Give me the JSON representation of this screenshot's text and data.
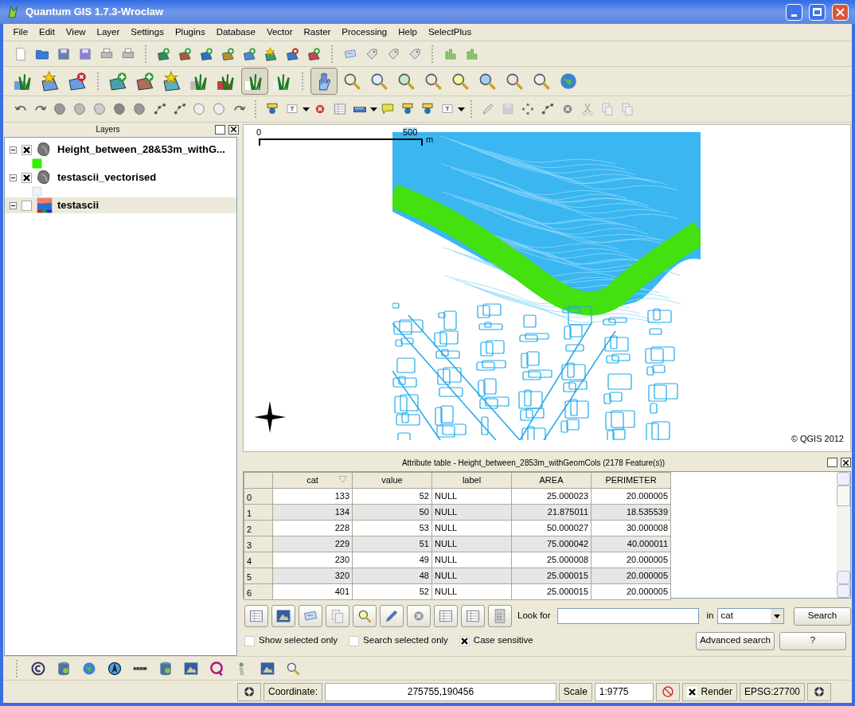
{
  "window": {
    "title": "Quantum GIS 1.7.3-Wroclaw"
  },
  "menu": [
    "File",
    "Edit",
    "View",
    "Layer",
    "Settings",
    "Plugins",
    "Database",
    "Vector",
    "Raster",
    "Processing",
    "Help",
    "SelectPlus"
  ],
  "toolbars": {
    "pan_tool": {
      "selected": true
    },
    "capture_tool": {
      "selected": true
    }
  },
  "layers_panel": {
    "title": "Layers",
    "layers": [
      {
        "name": "Height_between_28&53m_withG...",
        "kind": "vector",
        "checked": true,
        "selected": false,
        "expanded": true,
        "color": "#33ee00"
      },
      {
        "name": "testascii_vectorised",
        "kind": "vector",
        "checked": true,
        "selected": false,
        "expanded": true,
        "color": "#eef4fa"
      },
      {
        "name": "testascii",
        "kind": "raster",
        "checked": false,
        "selected": true,
        "expanded": true
      }
    ]
  },
  "map": {
    "scale_bar": {
      "start": "0",
      "end": "500",
      "unit": "m"
    },
    "copyright": "© QGIS 2012"
  },
  "attribute_table": {
    "title": "Attribute table - Height_between_2853m_withGeomCols (2178 Feature(s))",
    "columns": [
      {
        "label": "cat",
        "sorted": true
      },
      {
        "label": "value",
        "sorted": false
      },
      {
        "label": "label",
        "sorted": false
      },
      {
        "label": "AREA",
        "sorted": false
      },
      {
        "label": "PERIMETER",
        "sorted": false
      }
    ],
    "rows": [
      {
        "index": "0",
        "cells": [
          "133",
          "52",
          "NULL",
          "25.000023",
          "20.000005"
        ]
      },
      {
        "index": "1",
        "cells": [
          "134",
          "50",
          "NULL",
          "21.875011",
          "18.535539"
        ]
      },
      {
        "index": "2",
        "cells": [
          "228",
          "53",
          "NULL",
          "50.000027",
          "30.000008"
        ]
      },
      {
        "index": "3",
        "cells": [
          "229",
          "51",
          "NULL",
          "75.000042",
          "40.000011"
        ]
      },
      {
        "index": "4",
        "cells": [
          "230",
          "49",
          "NULL",
          "25.000008",
          "20.000005"
        ]
      },
      {
        "index": "5",
        "cells": [
          "320",
          "48",
          "NULL",
          "25.000015",
          "20.000005"
        ]
      },
      {
        "index": "6",
        "cells": [
          "401",
          "52",
          "NULL",
          "25.000015",
          "20.000005"
        ]
      }
    ]
  },
  "search": {
    "look_for_label": "Look for",
    "in_label": "in",
    "field": "cat",
    "search_button": "Search",
    "advanced_button": "Advanced search",
    "help_button": "?",
    "options": [
      {
        "label": "Show selected only",
        "checked": false
      },
      {
        "label": "Search selected only",
        "checked": false
      },
      {
        "label": "Case sensitive",
        "checked": true
      }
    ]
  },
  "status_bar": {
    "coordinate_label": "Coordinate:",
    "coordinate": "275755,190456",
    "scale_label": "Scale",
    "scale": "1:9775",
    "render": {
      "label": "Render",
      "checked": true
    },
    "crs": "EPSG:27700"
  }
}
